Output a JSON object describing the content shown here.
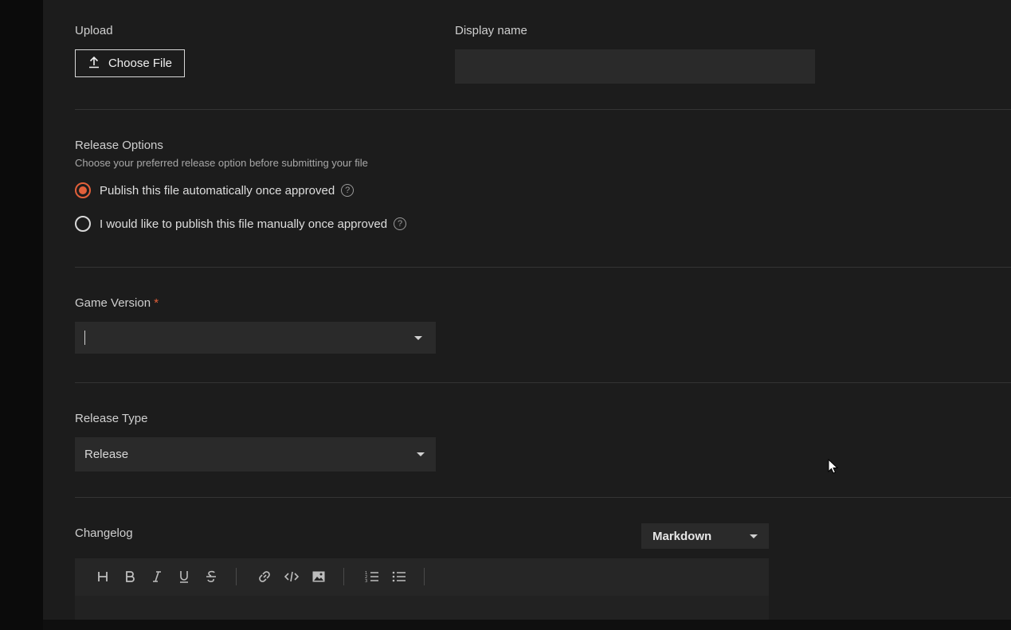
{
  "upload": {
    "label": "Upload",
    "button_label": "Choose File",
    "button_icon": "upload-icon"
  },
  "display_name": {
    "label": "Display name",
    "value": ""
  },
  "release_options": {
    "label": "Release Options",
    "description": "Choose your preferred release option before submitting your file",
    "options": [
      {
        "label": "Publish this file automatically once approved",
        "checked": true
      },
      {
        "label": "I would like to publish this file manually once approved",
        "checked": false
      }
    ],
    "help_glyph": "?"
  },
  "game_version": {
    "label": "Game Version",
    "required_marker": "*",
    "value": ""
  },
  "release_type": {
    "label": "Release Type",
    "value": "Release"
  },
  "changelog": {
    "label": "Changelog",
    "format": "Markdown",
    "toolbar": [
      "heading-icon",
      "bold-icon",
      "italic-icon",
      "underline-icon",
      "strikethrough-icon",
      "link-icon",
      "code-icon",
      "image-icon",
      "ordered-list-icon",
      "bullet-list-icon"
    ]
  },
  "colors": {
    "accent": "#e2603a",
    "panel": "#1c1c1c",
    "field": "#2a2a2a"
  }
}
